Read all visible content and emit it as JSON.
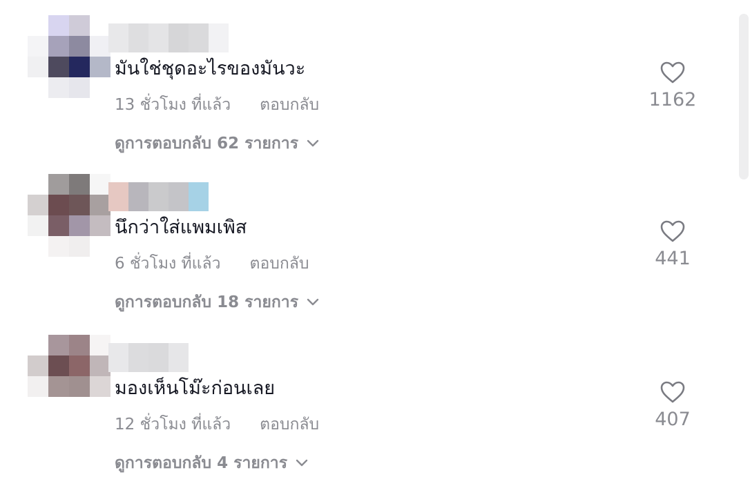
{
  "comments": [
    {
      "avatar_tiles": [
        [
          "#ffffff",
          "#d8d5f0",
          "#cfcbd8",
          "#ffffff"
        ],
        [
          "#f4f4f6",
          "#a6a2ba",
          "#8d8aa0",
          "#f0f0f4"
        ],
        [
          "#f0f0f2",
          "#4e4a5e",
          "#24285e",
          "#b4b8c8"
        ],
        [
          "#ffffff",
          "#ececf0",
          "#e6e6ec",
          "#ffffff"
        ]
      ],
      "username_tiles": [
        "#e8e8ea",
        "#dedee0",
        "#e4e4e6",
        "#d6d6d8",
        "#dadadc",
        "#f2f2f4"
      ],
      "text": "มันใช่ชุดอะไรของมันวะ",
      "time": "13 ชั่วโมง ที่แล้ว",
      "reply_label": "ตอบกลับ",
      "view_replies": "ดูการตอบกลับ 62 รายการ",
      "likes": "1162"
    },
    {
      "avatar_tiles": [
        [
          "#ffffff",
          "#a09c9c",
          "#7e7a7a",
          "#f6f6f6"
        ],
        [
          "#d4d0d0",
          "#6c4c50",
          "#6e5658",
          "#a8a0a0"
        ],
        [
          "#f2f2f2",
          "#7a5e66",
          "#a296a8",
          "#c4bcc0"
        ],
        [
          "#ffffff",
          "#f4f2f2",
          "#f0eeee",
          "#ffffff"
        ]
      ],
      "username_tiles": [
        "#e6c8c2",
        "#b8b6bc",
        "#cacacc",
        "#c4c4c8",
        "#a6d2e6"
      ],
      "text": "นึกว่าใส่แพมเพิส",
      "time": "6 ชั่วโมง ที่แล้ว",
      "reply_label": "ตอบกลับ",
      "view_replies": "ดูการตอบกลับ 18 รายการ",
      "likes": "441"
    },
    {
      "avatar_tiles": [
        [
          "#ffffff",
          "#a8969c",
          "#9c8488",
          "#f6f4f4"
        ],
        [
          "#d2cccc",
          "#6c4e52",
          "#8c6668",
          "#c0b6b8"
        ],
        [
          "#f2f0f0",
          "#a49494",
          "#a09090",
          "#dcd6d6"
        ],
        [
          "#ffffff",
          "#ffffff",
          "#ffffff",
          "#ffffff"
        ]
      ],
      "username_tiles": [
        "#e8e8ea",
        "#dcdcde",
        "#dadadc",
        "#e6e6e8"
      ],
      "text": "มองเห็นโม๊ะก่อนเลย",
      "time": "12 ชั่วโมง ที่แล้ว",
      "reply_label": "ตอบกลับ",
      "view_replies": "ดูการตอบกลับ 4 รายการ",
      "likes": "407"
    }
  ],
  "icons": {
    "like": "heart-outline-icon",
    "expand": "chevron-down-icon"
  },
  "colors": {
    "primary_text": "#161823",
    "secondary_text": "#8a8b91",
    "scrollbar": "#eeeeef"
  }
}
